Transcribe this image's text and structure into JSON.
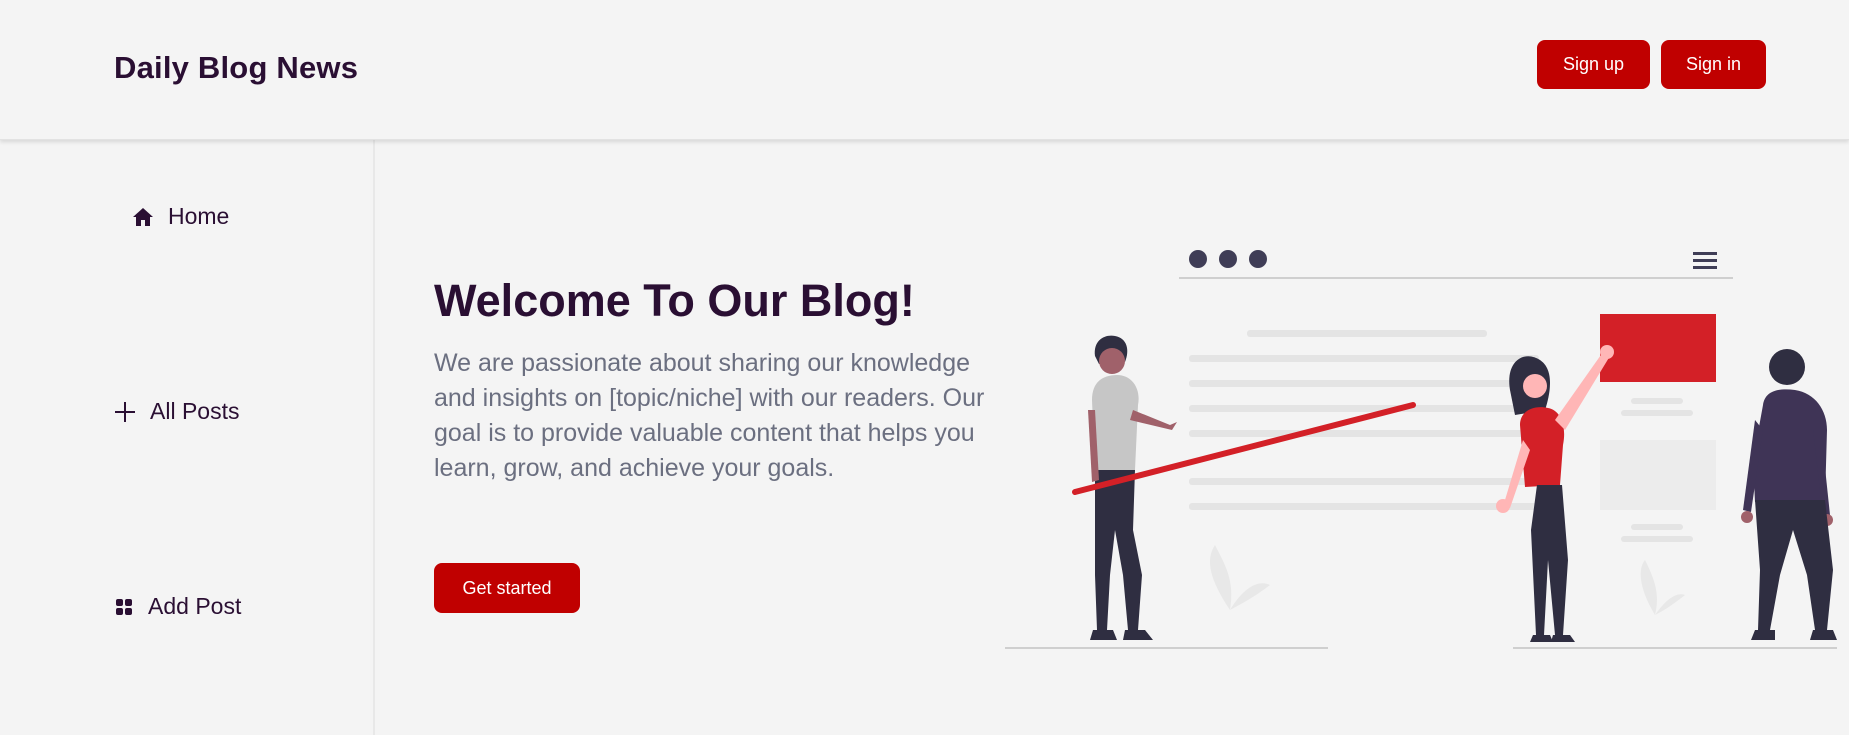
{
  "header": {
    "brand": "Daily Blog News",
    "signup_label": "Sign up",
    "signin_label": "Sign in"
  },
  "sidebar": {
    "items": [
      {
        "label": "Home",
        "icon": "home-icon"
      },
      {
        "label": "All Posts",
        "icon": "plus-icon"
      },
      {
        "label": "Add Post",
        "icon": "grid-icon"
      }
    ]
  },
  "hero": {
    "title": "Welcome To Our Blog!",
    "text": "We are passionate about sharing our knowledge and insights on [topic/niche] with our readers. Our goal is to provide valuable content that helps you learn, grow, and achieve your goals.",
    "cta_label": "Get started"
  },
  "colors": {
    "accent": "#c00000",
    "text_dark": "#2a0f33",
    "text_muted": "#6b6f80",
    "background": "#f4f4f4"
  }
}
